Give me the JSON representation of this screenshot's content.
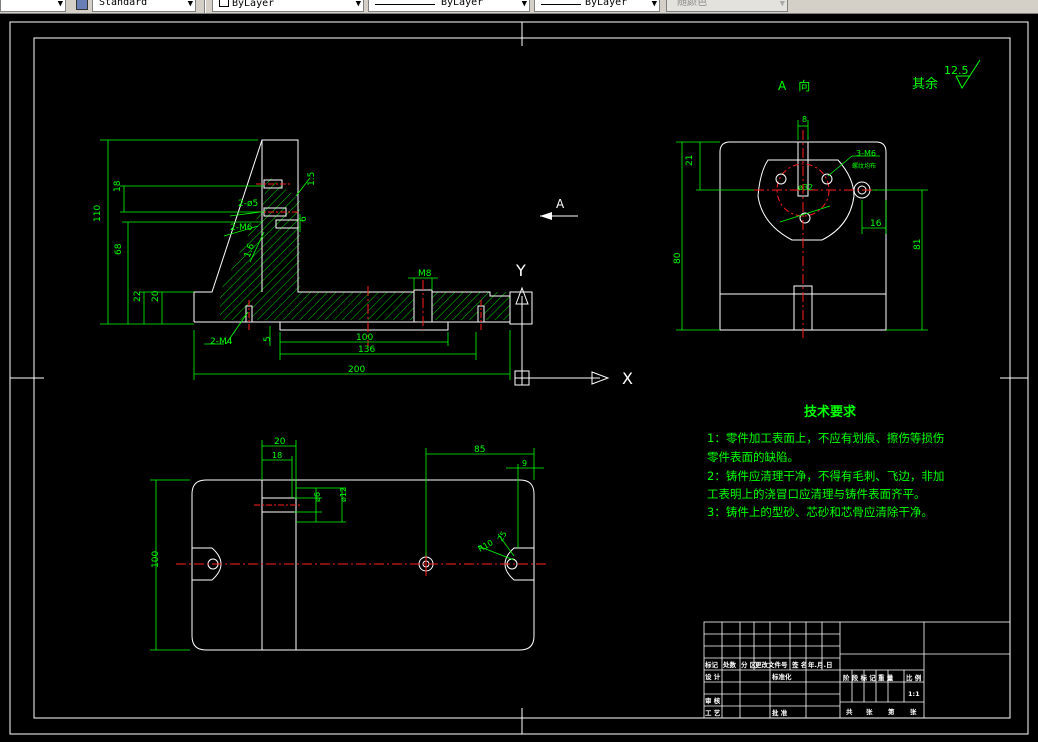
{
  "toolbar": {
    "textstyle": "Standard",
    "layer": "ByLayer",
    "linetype": "ByLayer",
    "lineweight": "ByLayer",
    "color": "随颜色"
  },
  "view": {
    "title": "A　向",
    "arrow_label": "A",
    "roughness_prefix": "其余",
    "roughness_value": "12.5",
    "axis_x": "X",
    "axis_y": "Y"
  },
  "front_dims": {
    "d110": "110",
    "d68": "68",
    "d22": "22",
    "d20": "20",
    "d18": "18",
    "d15": "1.5",
    "d6": "6",
    "d16": "1.6",
    "hole_a": "2-ø5",
    "hole_b": "2-M6",
    "hole_c": "2-M4",
    "m8": "M8",
    "d5": "5",
    "d100": "100",
    "d136": "136",
    "d200": "200"
  },
  "side_dims": {
    "d8": "8",
    "d21": "21",
    "d80": "80",
    "d81": "81",
    "d16": "16",
    "phi32": "ø32",
    "m6": "3-M6",
    "m6_note": "螺纹均布"
  },
  "plan_dims": {
    "d20": "20",
    "d18": "18",
    "d85": "85",
    "d9": "9",
    "d100": "100",
    "phi6": "ø6",
    "phi12": "ø12",
    "r10": "R10",
    "d25": "25"
  },
  "tech": {
    "title": "技术要求",
    "lines": [
      "1：零件加工表面上，不应有划痕、擦伤等损伤",
      "零件表面的缺陷。",
      "2：铸件应清理干净，不得有毛刺、飞边，非加",
      "工表明上的浇冒口应清理与铸件表面齐平。",
      "3：铸件上的型砂、芯砂和芯骨应清除干净。"
    ]
  },
  "title_block": {
    "header_row": [
      "标记",
      "处数",
      "分 区",
      "更改文件号",
      "签 名",
      "年.月.日"
    ],
    "design": "设 计",
    "standard": "标准化",
    "stage_row": [
      "阶 段 标 记",
      "重 量",
      "比 例"
    ],
    "scale": "1:1",
    "audit": "审 核",
    "process": "工 艺",
    "approve": "批 准",
    "sheets": [
      "共",
      "张",
      "第",
      "张"
    ]
  }
}
